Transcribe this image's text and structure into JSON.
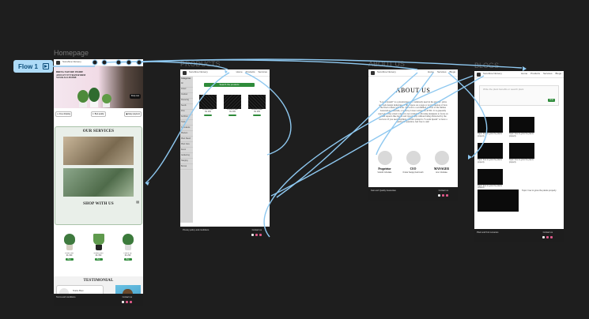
{
  "flow": {
    "label": "Flow 1"
  },
  "frames": {
    "homepage": {
      "label": "Homepage",
      "brand": "Sunshine Nursery",
      "hero_text": "BRING NATURE INSIDE AND LET IT TRANSFORM YOUR ALL HOME",
      "hero_cta": "Shop now",
      "pills": [
        "Free shipping",
        "Best quality",
        "Easy payment"
      ],
      "services_title": "OUR SERVICES",
      "shop_title": "SHOP WITH US",
      "products": [
        {
          "name": "Fiddle leaf",
          "price": "Rs 499"
        },
        {
          "name": "Snake plant",
          "price": "Rs 399"
        },
        {
          "name": "Peace lily",
          "price": "Rs 299"
        }
      ],
      "buy_label": "Buy",
      "testimonial_title": "TESTIMONIAL",
      "testimonial_name": "Name Here",
      "testimonial_quote": "“The Nursery plants are fresh, healthy and the customer service is excellent.”",
      "footer_left": "Terms and conditions",
      "footer_right": "Contact us"
    },
    "products": {
      "label": "PRODUCTS",
      "brand": "Sunshine Nursery",
      "search_btn": "Search the products",
      "sidebar_title": "Categories",
      "sidebar": [
        "All",
        "Indoor",
        "Outdoor",
        "Flowering",
        "Seeds",
        "Pots",
        "Fertilizer",
        "Tools",
        "Succulents",
        "Planters",
        "Plant Stand",
        "Plant Care",
        "Decor",
        "Gardening",
        "Hanging",
        "Bonsai"
      ],
      "cards": [
        {
          "name": "Aroma Plate",
          "price": "Rs 299"
        },
        {
          "name": "Aroma Plate",
          "price": "Rs 299"
        },
        {
          "name": "Aroma Plate",
          "price": "Rs 299"
        }
      ],
      "footer_left": "Privacy policy and conditions",
      "footer_right": "Contact us"
    },
    "about": {
      "label": "ABOUT US",
      "brand": "Sunshine Nursery",
      "heading": "ABOUT US",
      "body": "“Lorem Ipsum” is a placeholder text commonly used in the graphic, print, and web design industries to fill a space on a page or an impression of how the final content will look. The text is a scrambled section of De finibus bonorum et malorum, a work by Cicero written in 45 BC. It is generally used when the actual content is not available, allowing designers to focus on visual aspects like layout and typography without being distracted by the real text. If you need anything specific related to “Lorem Ipsum” or have a particular question, feel free to ask!",
      "team": [
        {
          "role": "Proprietor",
          "name": "Subodh Ghodake"
        },
        {
          "role": "CEO",
          "name": "Omkar Sanjay Deshmukh"
        },
        {
          "role": "MANAGER",
          "name": "Arun Ghodake"
        }
      ],
      "footer_left": "Fast and Quality Guarantee",
      "footer_right": "Contact us"
    },
    "blogs": {
      "label": "BLOGS",
      "brand": "Sunshine Nursery",
      "nav": [
        "Home",
        "Products",
        "Services",
        "Blogs"
      ],
      "search_placeholder": "Write the plant benefits or search plant",
      "search_btn": "Find",
      "post_title": "Topic: how to grow the plants properly",
      "footer_left": "Plant and fruit nurseries",
      "footer_right": "Contact us"
    }
  },
  "colors": {
    "canvas": "#1e1e1e",
    "wire": "#8ec8f0",
    "accent": "#2e8b3a"
  }
}
